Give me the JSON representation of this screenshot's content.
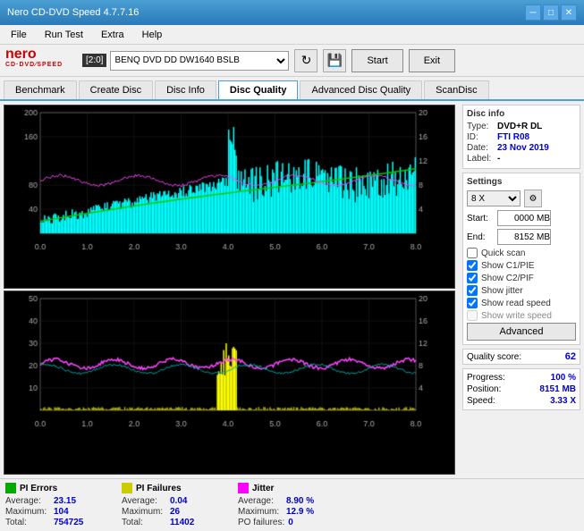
{
  "titlebar": {
    "title": "Nero CD-DVD Speed 4.7.7.16",
    "minimize": "─",
    "maximize": "□",
    "close": "✕"
  },
  "menu": {
    "items": [
      "File",
      "Run Test",
      "Extra",
      "Help"
    ]
  },
  "toolbar": {
    "drive_label": "[2:0]",
    "drive_name": "BENQ DVD DD DW1640 BSLB",
    "start_label": "Start",
    "exit_label": "Exit"
  },
  "tabs": [
    {
      "label": "Benchmark",
      "active": false
    },
    {
      "label": "Create Disc",
      "active": false
    },
    {
      "label": "Disc Info",
      "active": false
    },
    {
      "label": "Disc Quality",
      "active": true
    },
    {
      "label": "Advanced Disc Quality",
      "active": false
    },
    {
      "label": "ScanDisc",
      "active": false
    }
  ],
  "disc_info": {
    "title": "Disc info",
    "type_label": "Type:",
    "type_value": "DVD+R DL",
    "id_label": "ID:",
    "id_value": "FTI R08",
    "date_label": "Date:",
    "date_value": "23 Nov 2019",
    "label_label": "Label:",
    "label_value": "-"
  },
  "settings": {
    "title": "Settings",
    "speed": "8 X",
    "start_label": "Start:",
    "start_value": "0000 MB",
    "end_label": "End:",
    "end_value": "8152 MB",
    "quick_scan": false,
    "show_c1pie": true,
    "show_c2pif": true,
    "show_jitter": true,
    "show_read_speed": true,
    "show_write_speed": false,
    "advanced_label": "Advanced"
  },
  "quality": {
    "label": "Quality score:",
    "value": "62"
  },
  "progress": {
    "progress_label": "Progress:",
    "progress_value": "100 %",
    "position_label": "Position:",
    "position_value": "8151 MB",
    "speed_label": "Speed:",
    "speed_value": "3.33 X"
  },
  "stats": {
    "pi_errors": {
      "title": "PI Errors",
      "color": "#00aa00",
      "average_label": "Average:",
      "average_value": "23.15",
      "maximum_label": "Maximum:",
      "maximum_value": "104",
      "total_label": "Total:",
      "total_value": "754725"
    },
    "pi_failures": {
      "title": "PI Failures",
      "color": "#cccc00",
      "average_label": "Average:",
      "average_value": "0.04",
      "maximum_label": "Maximum:",
      "maximum_value": "26",
      "total_label": "Total:",
      "total_value": "11402"
    },
    "jitter": {
      "title": "Jitter",
      "color": "#ff00ff",
      "average_label": "Average:",
      "average_value": "8.90 %",
      "maximum_label": "Maximum:",
      "maximum_value": "12.9 %"
    },
    "po_failures": {
      "label": "PO failures:",
      "value": "0"
    }
  },
  "chart1": {
    "y_max": 200,
    "y_labels": [
      "200",
      "160",
      "80",
      "40"
    ],
    "x_labels": [
      "0.0",
      "1.0",
      "2.0",
      "3.0",
      "4.0",
      "5.0",
      "6.0",
      "7.0",
      "8.0"
    ],
    "right_labels": [
      "20",
      "16",
      "12",
      "8",
      "4"
    ]
  },
  "chart2": {
    "y_max": 50,
    "y_labels": [
      "50",
      "40",
      "30",
      "20",
      "10"
    ],
    "x_labels": [
      "0.0",
      "1.0",
      "2.0",
      "3.0",
      "4.0",
      "5.0",
      "6.0",
      "7.0",
      "8.0"
    ],
    "right_labels": [
      "20",
      "16",
      "12",
      "8",
      "4"
    ]
  }
}
